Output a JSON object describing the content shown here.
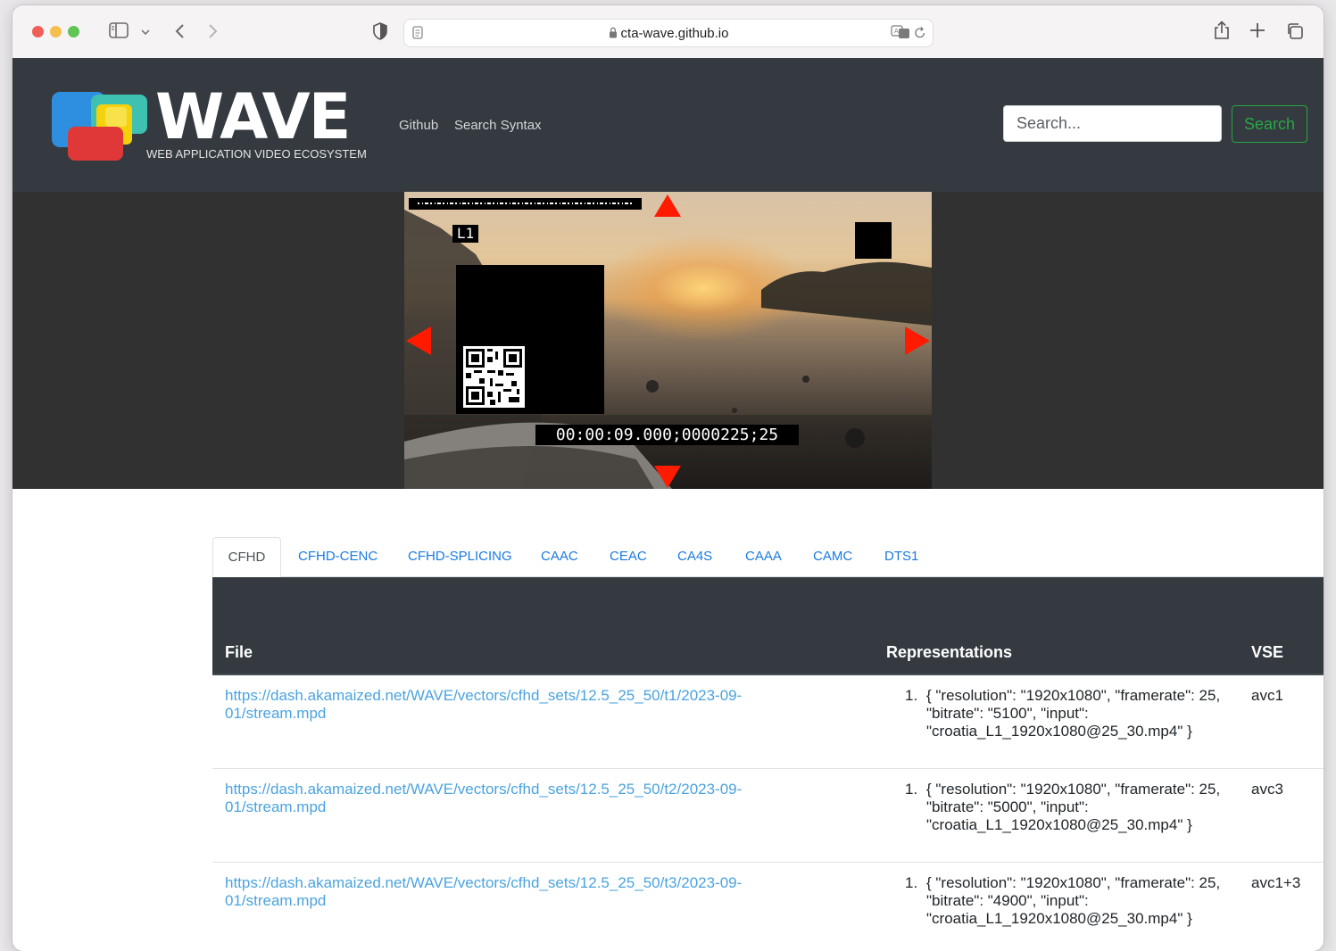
{
  "browser": {
    "address": "cta-wave.github.io"
  },
  "nav": {
    "logo_title": "WAVE",
    "logo_subtitle": "WEB APPLICATION VIDEO ECOSYSTEM",
    "links": [
      "Github",
      "Search Syntax"
    ],
    "search_placeholder": "Search...",
    "search_button": "Search"
  },
  "video": {
    "layer_label": "L1",
    "timecode": "00:00:09.000;0000225;25"
  },
  "tabs": [
    "CFHD",
    "CFHD-CENC",
    "CFHD-SPLICING",
    "CAAC",
    "CEAC",
    "CA4S",
    "CAAA",
    "CAMC",
    "DTS1"
  ],
  "active_tab": "CFHD",
  "table": {
    "headers": [
      "File",
      "Representations",
      "VSE"
    ],
    "rows": [
      {
        "file": "https://dash.akamaized.net/WAVE/vectors/cfhd_sets/12.5_25_50/t1/2023-09-01/stream.mpd",
        "rep_num": "1.",
        "rep": "{ \"resolution\": \"1920x1080\", \"framerate\": 25, \"bitrate\": \"5100\", \"input\": \"croatia_L1_1920x1080@25_30.mp4\" }",
        "vse": "avc1"
      },
      {
        "file": "https://dash.akamaized.net/WAVE/vectors/cfhd_sets/12.5_25_50/t2/2023-09-01/stream.mpd",
        "rep_num": "1.",
        "rep": "{ \"resolution\": \"1920x1080\", \"framerate\": 25, \"bitrate\": \"5000\", \"input\": \"croatia_L1_1920x1080@25_30.mp4\" }",
        "vse": "avc3"
      },
      {
        "file": "https://dash.akamaized.net/WAVE/vectors/cfhd_sets/12.5_25_50/t3/2023-09-01/stream.mpd",
        "rep_num": "1.",
        "rep": "{ \"resolution\": \"1920x1080\", \"framerate\": 25, \"bitrate\": \"4900\", \"input\": \"croatia_L1_1920x1080@25_30.mp4\" }",
        "vse": "avc1+3"
      }
    ]
  },
  "colors": {
    "nav_bg": "#343a40",
    "link": "#4aa3df",
    "search_green": "#28a745",
    "marker_red": "#ff1a00"
  }
}
